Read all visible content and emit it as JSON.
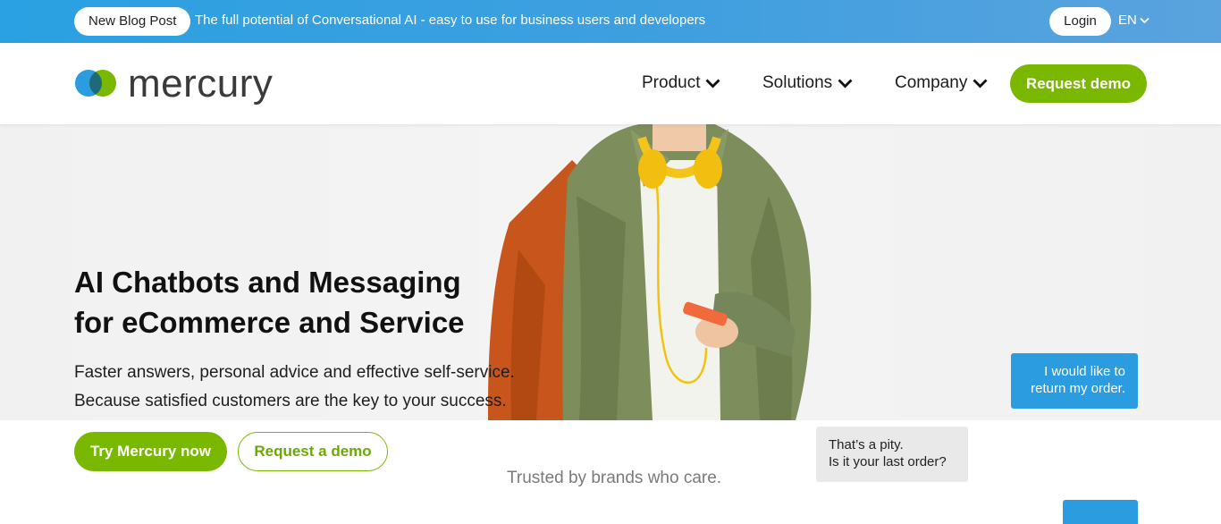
{
  "topbar": {
    "badge": "New Blog Post",
    "announcement": "The full potential of Conversational AI - easy to use for business users and developers",
    "login_label": "Login",
    "language": "EN"
  },
  "header": {
    "brand": "mercury",
    "nav": [
      {
        "label": "Product"
      },
      {
        "label": "Solutions"
      },
      {
        "label": "Company"
      }
    ],
    "cta_label": "Request demo"
  },
  "hero": {
    "headline_line1": "AI Chatbots and Messaging",
    "headline_line2": "for eCommerce and Service",
    "sub_line1": "Faster answers, personal advice and effective self-service.",
    "sub_line2": "Because satisfied customers are the key to your success.",
    "primary_button": "Try Mercury now",
    "secondary_button": "Request a demo",
    "trusted": "Trusted by brands who care."
  },
  "chat": {
    "user_message_line1": "I would like to",
    "user_message_line2": "return my order.",
    "bot_message_line1": "That’s a pity.",
    "bot_message_line2": "Is it your last order?"
  },
  "colors": {
    "brand_green": "#7ab800",
    "topbar_blue": "#2aa1e2",
    "chat_blue": "#2b9ce0",
    "chat_grey": "#e9e9e9"
  },
  "icons": {
    "nav_dropdown": "chevron-down-icon",
    "language_dropdown": "chevron-down-icon"
  }
}
